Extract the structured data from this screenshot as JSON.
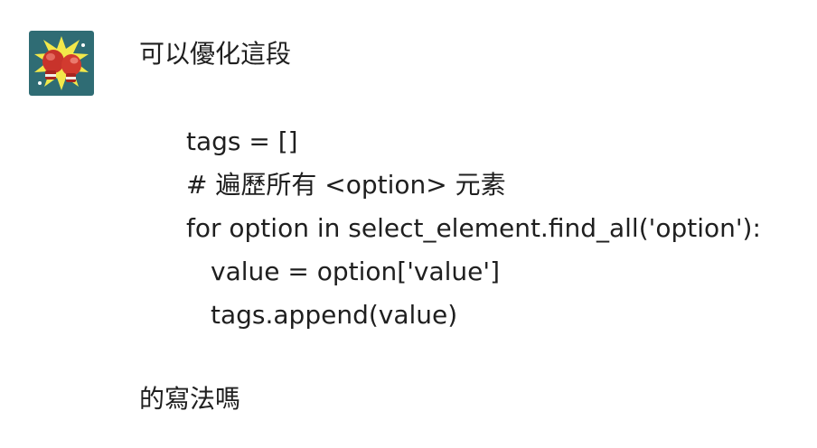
{
  "avatar": {
    "icon": "boxing-gloves-icon",
    "background": "#2f6c74"
  },
  "message": {
    "intro": "可以優化這段",
    "code_lines": [
      "tags = []",
      "# 遍歷所有 <option> 元素",
      "for option in select_element.find_all('option'):",
      "value = option['value']",
      "tags.append(value)"
    ],
    "outro": "的寫法嗎"
  }
}
